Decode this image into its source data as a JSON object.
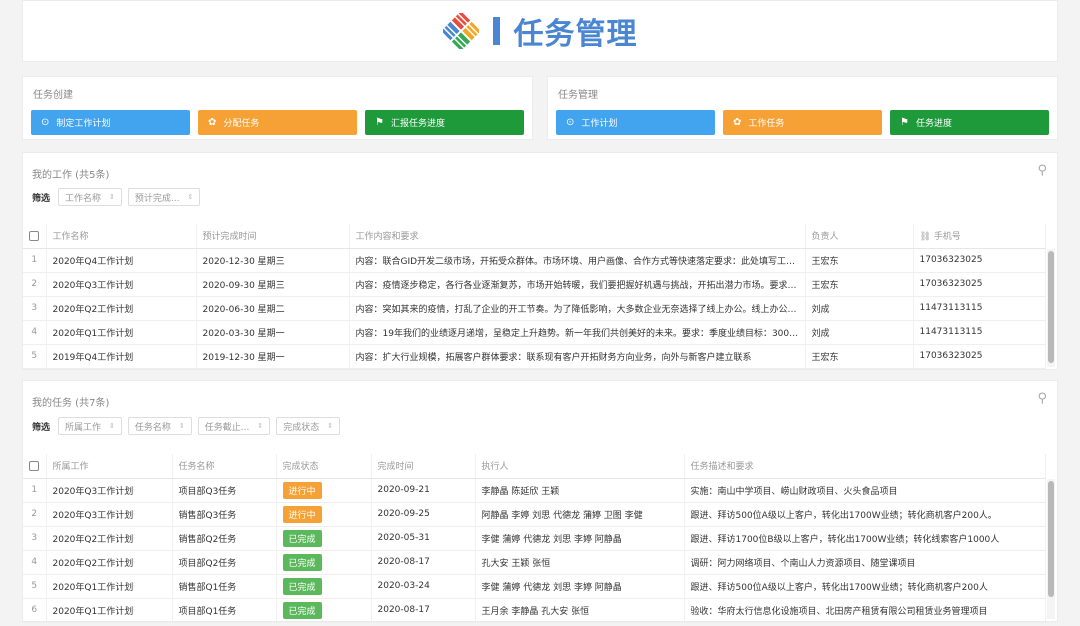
{
  "header": {
    "title": "任务管理"
  },
  "create_panel": {
    "title": "任务创建",
    "buttons": [
      {
        "label": "制定工作计划",
        "icon": "circle-dot-icon"
      },
      {
        "label": "分配任务",
        "icon": "gift-icon"
      },
      {
        "label": "汇报任务进度",
        "icon": "flag-icon"
      }
    ]
  },
  "manage_panel": {
    "title": "任务管理",
    "buttons": [
      {
        "label": "工作计划",
        "icon": "circle-dot-icon"
      },
      {
        "label": "工作任务",
        "icon": "gift-icon"
      },
      {
        "label": "任务进度",
        "icon": "flag-icon"
      }
    ]
  },
  "my_work": {
    "title": "我的工作 (共5条)",
    "filter_label": "筛选",
    "filters": [
      "工作名称",
      "预计完成..."
    ],
    "columns": [
      "工作名称",
      "预计完成时间",
      "工作内容和要求",
      "负责人",
      "手机号"
    ],
    "rows": [
      {
        "idx": "1",
        "name": "2020年Q4工作计划",
        "due": "2020-12-30 星期三",
        "content": "内容：联合GID开发二级市场，开拓受众群体。市场环境、用户画像、合作方式等快速落定要求：此处填写工…",
        "owner": "王宏东",
        "phone": "17036323025"
      },
      {
        "idx": "2",
        "name": "2020年Q3工作计划",
        "due": "2020-09-30 星期三",
        "content": "内容：疫情逐步稳定，各行各业逐渐复苏，市场开始转暖，我们要把握好机遇与挑战，开拓出潜力市场。要求…",
        "owner": "王宏东",
        "phone": "17036323025"
      },
      {
        "idx": "3",
        "name": "2020年Q2工作计划",
        "due": "2020-06-30 星期二",
        "content": "内容：突如其来的疫情，打乱了企业的开工节奏。为了降低影响，大多数企业无奈选择了线上办公。线上办公…",
        "owner": "刘成",
        "phone": "11473113115"
      },
      {
        "idx": "4",
        "name": "2020年Q1工作计划",
        "due": "2020-03-30 星期一",
        "content": "内容：19年我们的业绩逐月递增，呈稳定上升趋势。新一年我们共创美好的未来。要求：季度业绩目标：300…",
        "owner": "刘成",
        "phone": "11473113115"
      },
      {
        "idx": "5",
        "name": "2019年Q4工作计划",
        "due": "2019-12-30 星期一",
        "content": "内容：扩大行业规模，拓展客户群体要求：联系现有客户开拓财务方向业务，向外与新客户建立联系",
        "owner": "王宏东",
        "phone": "17036323025"
      }
    ]
  },
  "my_tasks": {
    "title": "我的任务 (共7条)",
    "filter_label": "筛选",
    "filters": [
      "所属工作",
      "任务名称",
      "任务截止...",
      "完成状态"
    ],
    "columns": [
      "所属工作",
      "任务名称",
      "完成状态",
      "完成时间",
      "执行人",
      "任务描述和要求"
    ],
    "rows": [
      {
        "idx": "1",
        "work": "2020年Q3工作计划",
        "task": "项目部Q3任务",
        "status": "进行中",
        "status_color": "#f6a136",
        "done": "2020-09-21",
        "people": "李静晶 陈延欣 王颖",
        "desc": "实施：南山中学项目、崂山财政项目、火头食品项目"
      },
      {
        "idx": "2",
        "work": "2020年Q3工作计划",
        "task": "销售部Q3任务",
        "status": "进行中",
        "status_color": "#f6a136",
        "done": "2020-09-25",
        "people": "阿静晶 李婷 刘思 代德龙 蒲婷 卫图 李健",
        "desc": "跟进、拜访500位A级以上客户，转化出1700W业绩；转化商机客户200人。"
      },
      {
        "idx": "3",
        "work": "2020年Q2工作计划",
        "task": "销售部Q2任务",
        "status": "已完成",
        "status_color": "#5cb85c",
        "done": "2020-05-31",
        "people": "李健 蒲婷 代德龙 刘思 李婷 阿静晶",
        "desc": "跟进、拜访1700位B级以上客户，转化出1700W业绩；转化线索客户1000人"
      },
      {
        "idx": "4",
        "work": "2020年Q2工作计划",
        "task": "项目部Q2任务",
        "status": "已完成",
        "status_color": "#5cb85c",
        "done": "2020-08-17",
        "people": "孔大安 王颖 张恒",
        "desc": "调研：阿力网络项目、个南山人力资源项目、随堂课项目"
      },
      {
        "idx": "5",
        "work": "2020年Q1工作计划",
        "task": "销售部Q1任务",
        "status": "已完成",
        "status_color": "#5cb85c",
        "done": "2020-03-24",
        "people": "李健 蒲婷 代德龙 刘思 李婷 阿静晶",
        "desc": "跟进、拜访500位A级以上客户，转化出1700W业绩；转化商机客户200人"
      },
      {
        "idx": "6",
        "work": "2020年Q1工作计划",
        "task": "项目部Q1任务",
        "status": "已完成",
        "status_color": "#5cb85c",
        "done": "2020-08-17",
        "people": "王月余 李静晶 孔大安 张恒",
        "desc": "验收：华府太行信息化设施项目、北田房产租赁有限公司租赁业务管理项目"
      }
    ]
  }
}
